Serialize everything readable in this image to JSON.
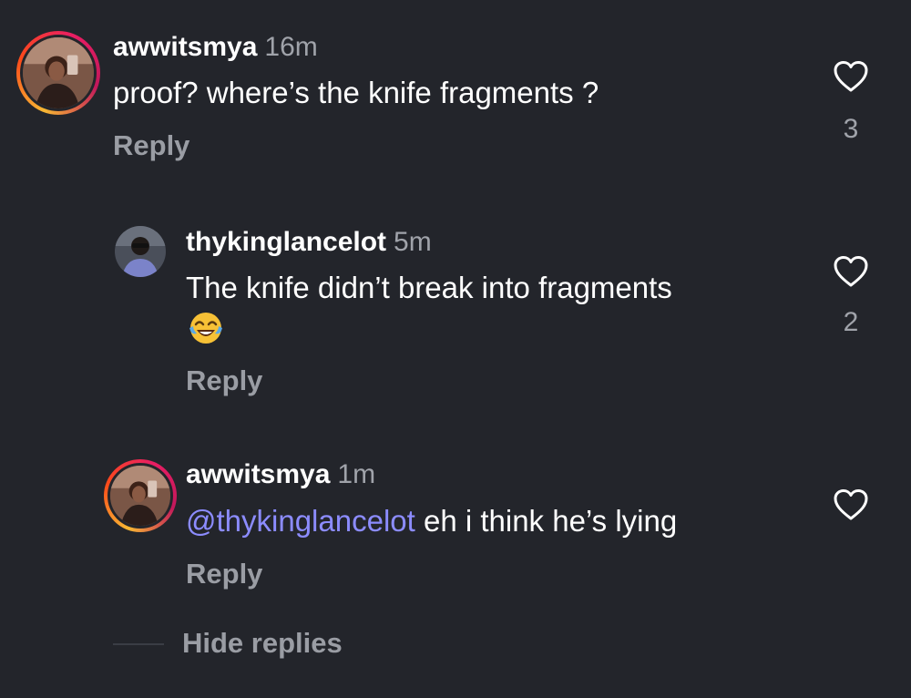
{
  "comments": [
    {
      "username": "awwitsmya",
      "time": "16m",
      "text": "proof? where’s the knife fragments ?",
      "reply_label": "Reply",
      "likes": "3"
    },
    {
      "username": "thykinglancelot",
      "time": "5m",
      "text": "The knife didn’t break into fragments",
      "emoji": "face-with-tears-of-joy",
      "reply_label": "Reply",
      "likes": "2"
    },
    {
      "username": "awwitsmya",
      "time": "1m",
      "mention": "@thykinglancelot",
      "text": " eh i think he’s lying",
      "reply_label": "Reply",
      "likes": ""
    }
  ],
  "hide_replies_label": "Hide replies",
  "colors": {
    "background": "#23252b",
    "mention": "#8c8cff",
    "secondary_text": "#9a9da4"
  }
}
